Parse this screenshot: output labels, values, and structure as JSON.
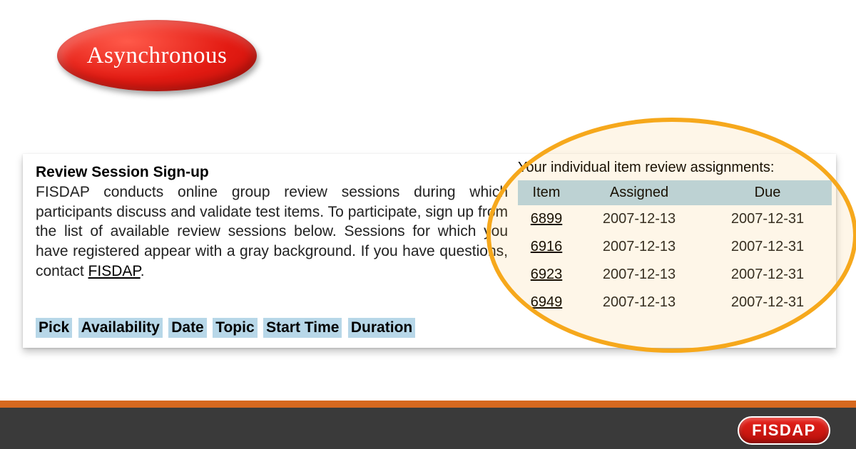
{
  "badge": {
    "label": "Asynchronous"
  },
  "signup": {
    "title": "Review Session Sign-up",
    "description_pre": "FISDAP conducts online group review sessions during which participants discuss and validate test items. To participate, sign up from the list of available review sessions below. Sessions for which you have registered appear with a gray background. If you have questions, contact ",
    "description_link": "FISDAP",
    "description_post": "."
  },
  "session_columns": [
    "Pick",
    "Availability",
    "Date",
    "Topic",
    "Start Time",
    "Duration"
  ],
  "assignments": {
    "title": "Your individual item review assignments:",
    "columns": {
      "item": "Item",
      "assigned": "Assigned",
      "due": "Due"
    },
    "rows": [
      {
        "item": "6899",
        "assigned": "2007-12-13",
        "due": "2007-12-31"
      },
      {
        "item": "6916",
        "assigned": "2007-12-13",
        "due": "2007-12-31"
      },
      {
        "item": "6923",
        "assigned": "2007-12-13",
        "due": "2007-12-31"
      },
      {
        "item": "6949",
        "assigned": "2007-12-13",
        "due": "2007-12-31"
      }
    ]
  },
  "footer": {
    "logo_text": "FISDAP"
  }
}
